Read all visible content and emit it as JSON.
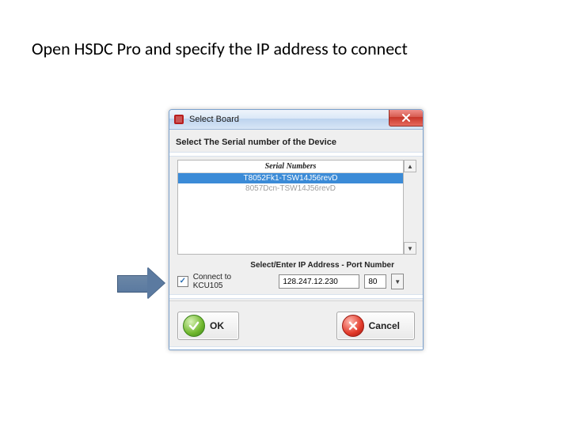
{
  "slide": {
    "title": "Open HSDC Pro and specify the IP address to connect"
  },
  "dialog": {
    "window_title": "Select Board",
    "prompt": "Select The Serial number of the Device",
    "list_header": "Serial Numbers",
    "serial_items": [
      "T8052Fk1-TSW14J56revD",
      "8057Dcn-TSW14J56revD"
    ],
    "selected_index": 0,
    "ip_section_label": "Select/Enter IP Address - Port Number",
    "connect_checkbox_label": "Connect to KCU105",
    "connect_checked": true,
    "ip_value": "128.247.12.230",
    "port_value": "80",
    "ok_label": "OK",
    "cancel_label": "Cancel"
  }
}
